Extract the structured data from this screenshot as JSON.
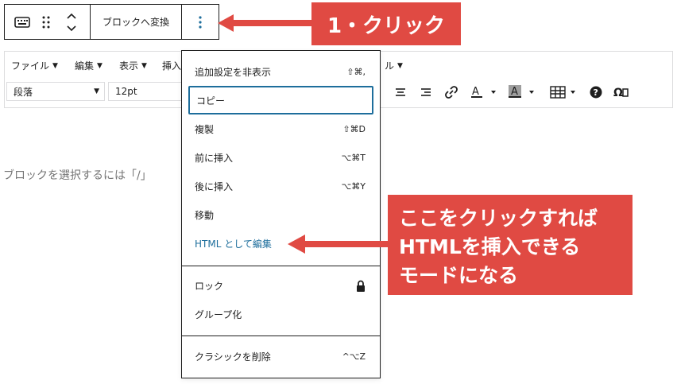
{
  "block_toolbar": {
    "convert_label": "ブロックへ変換"
  },
  "classic_toolbar": {
    "menus": [
      "ファイル",
      "編集",
      "表示",
      "挿入"
    ],
    "menu_tail_caret": "▼",
    "format_select": "段落",
    "size_select": "12pt"
  },
  "editor": {
    "placeholder": "ブロックを選択するには「/」"
  },
  "dropdown": {
    "items": [
      {
        "label": "追加設定を非表示",
        "shortcut": "⇧⌘,"
      },
      {
        "label": "コピー",
        "shortcut": ""
      },
      {
        "label": "複製",
        "shortcut": "⇧⌘D"
      },
      {
        "label": "前に挿入",
        "shortcut": "⌥⌘T"
      },
      {
        "label": "後に挿入",
        "shortcut": "⌥⌘Y"
      },
      {
        "label": "移動",
        "shortcut": ""
      },
      {
        "label": "HTML として編集",
        "shortcut": ""
      },
      {
        "label": "ロック",
        "shortcut": ""
      },
      {
        "label": "グループ化",
        "shortcut": ""
      },
      {
        "label": "クラシックを削除",
        "shortcut": "^⌥Z"
      }
    ]
  },
  "callouts": {
    "step1": "1・クリック",
    "step2_lines": [
      "ここをクリックすれば",
      "HTMLを挿入できる",
      "モードになる"
    ]
  },
  "colors": {
    "callout_red": "#e04a43",
    "link_blue": "#1e6e9c"
  },
  "icons": [
    "keyboard-icon",
    "drag-handle-icon",
    "move-up-down-icon",
    "more-options-icon",
    "lock-icon",
    "align-center-icon",
    "align-right-icon",
    "link-icon",
    "text-color-icon",
    "background-color-icon",
    "table-icon",
    "help-icon",
    "special-char-icon"
  ]
}
